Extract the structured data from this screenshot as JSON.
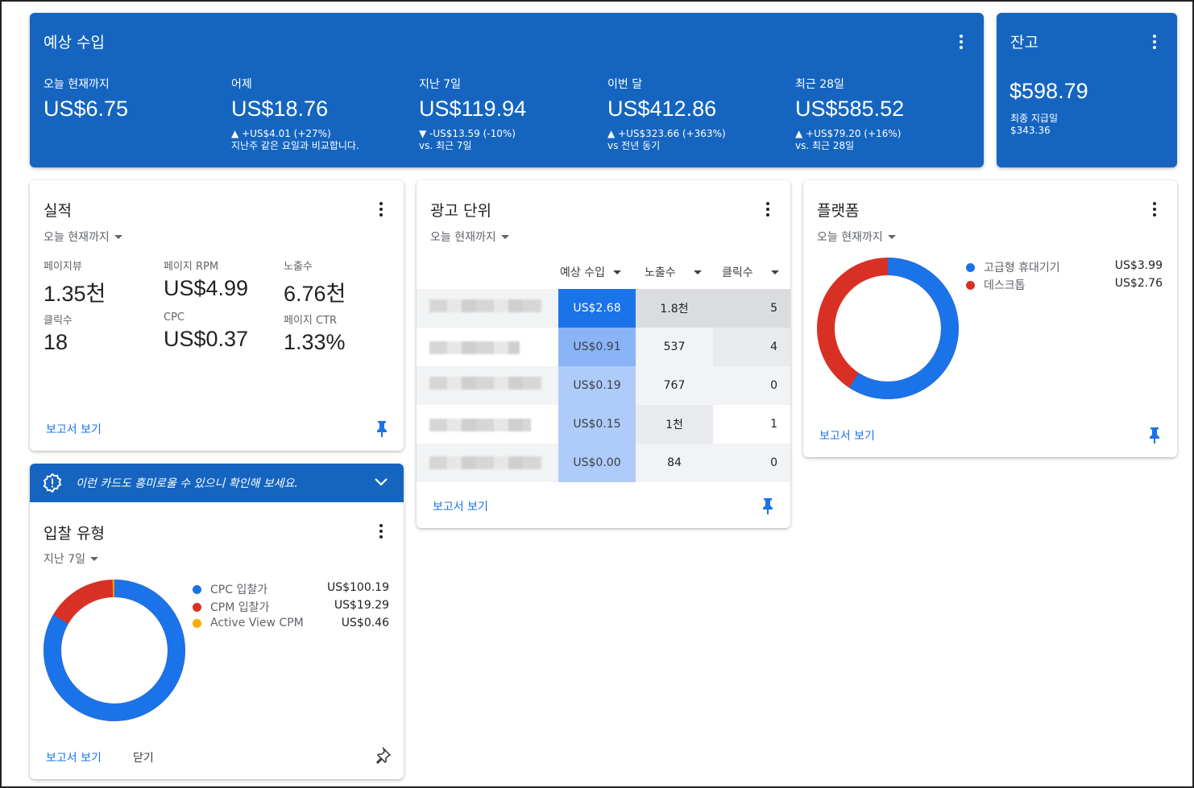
{
  "earnings": {
    "title": "예상 수입",
    "items": [
      {
        "label": "오늘 현재까지",
        "value": "US$6.75",
        "delta": "",
        "note": ""
      },
      {
        "label": "어제",
        "value": "US$18.76",
        "delta": "▲ +US$4.01 (+27%)",
        "note": "지난주 같은 요일과 비교합니다."
      },
      {
        "label": "지난 7일",
        "value": "US$119.94",
        "delta": "▼ -US$13.59 (-10%)",
        "note": "vs. 최근 7일"
      },
      {
        "label": "이번 달",
        "value": "US$412.86",
        "delta": "▲ +US$323.66 (+363%)",
        "note": "vs 전년 동기"
      },
      {
        "label": "최근 28일",
        "value": "US$585.52",
        "delta": "▲ +US$79.20 (+16%)",
        "note": "vs. 최근 28일"
      }
    ]
  },
  "balance": {
    "title": "잔고",
    "value": "$598.79",
    "label": "최종 지급일",
    "last_payment": "$343.36"
  },
  "performance": {
    "title": "실적",
    "range": "오늘 현재까지",
    "metrics": [
      {
        "label": "페이지뷰",
        "value": "1.35천"
      },
      {
        "label": "페이지 RPM",
        "value": "US$4.99"
      },
      {
        "label": "노출수",
        "value": "6.76천"
      },
      {
        "label": "클릭수",
        "value": "18"
      },
      {
        "label": "CPC",
        "value": "US$0.37"
      },
      {
        "label": "페이지 CTR",
        "value": "1.33%"
      }
    ],
    "report_link": "보고서 보기"
  },
  "ad_units": {
    "title": "광고 단위",
    "range": "오늘 현재까지",
    "columns": [
      "예상 수입",
      "노출수",
      "클릭수"
    ],
    "rows": [
      {
        "earnings": "US$2.68",
        "impressions": "1.8천",
        "clicks": "5"
      },
      {
        "earnings": "US$0.91",
        "impressions": "537",
        "clicks": "4"
      },
      {
        "earnings": "US$0.19",
        "impressions": "767",
        "clicks": "0"
      },
      {
        "earnings": "US$0.15",
        "impressions": "1천",
        "clicks": "1"
      },
      {
        "earnings": "US$0.00",
        "impressions": "84",
        "clicks": "0"
      }
    ],
    "report_link": "보고서 보기"
  },
  "platform": {
    "title": "플랫폼",
    "range": "오늘 현재까지",
    "legend": [
      {
        "name": "고급형 휴대기기",
        "value": "US$3.99",
        "color": "#1a73e8"
      },
      {
        "name": "데스크톱",
        "value": "US$2.76",
        "color": "#d93025"
      }
    ],
    "report_link": "보고서 보기"
  },
  "bid_type": {
    "banner": "이런 카드도 흥미로울 수 있으니 확인해 보세요.",
    "title": "입찰 유형",
    "range": "지난 7일",
    "legend": [
      {
        "name": "CPC 입찰가",
        "value": "US$100.19",
        "color": "#1a73e8"
      },
      {
        "name": "CPM 입찰가",
        "value": "US$19.29",
        "color": "#d93025"
      },
      {
        "name": "Active View CPM",
        "value": "US$0.46",
        "color": "#f9ab00"
      }
    ],
    "report_link": "보고서 보기",
    "close_link": "닫기"
  }
}
